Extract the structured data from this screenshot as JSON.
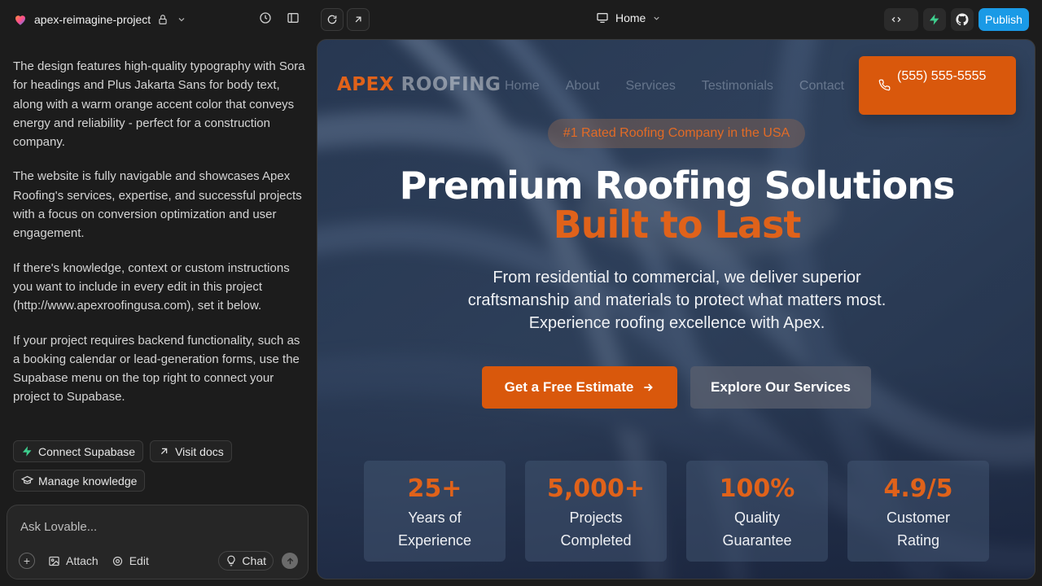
{
  "project": {
    "name": "apex-reimagine-project"
  },
  "chat": {
    "paragraphs": [
      "The design features high-quality typography with Sora for headings and Plus Jakarta Sans for body text, along with a warm orange accent color that conveys energy and reliability - perfect for a construction company.",
      "The website is fully navigable and showcases Apex Roofing's services, expertise, and successful projects with a focus on conversion optimization and user engagement.",
      "If there's knowledge, context or custom instructions you want to include in every edit in this project (http://www.apexroofingusa.com), set it below.",
      "If your project requires backend functionality, such as a booking calendar or lead-generation forms, use the Supabase menu on the top right to connect your project to Supabase."
    ],
    "chips": {
      "connect": "Connect Supabase",
      "docs": "Visit docs",
      "knowledge": "Manage knowledge"
    }
  },
  "composer": {
    "placeholder": "Ask Lovable...",
    "attach": "Attach",
    "edit": "Edit",
    "chat": "Chat"
  },
  "topbar": {
    "route": "Home",
    "publish": "Publish"
  },
  "site": {
    "logo_a": "APEX",
    "logo_b": "ROOFING",
    "nav": [
      "Home",
      "About",
      "Services",
      "Testimonials",
      "Contact"
    ],
    "phone": "(555) 555-5555",
    "badge": "#1 Rated Roofing Company in the USA",
    "headline_1": "Premium Roofing Solutions",
    "headline_2": "Built to Last",
    "subhead": "From residential to commercial, we deliver superior craftsmanship and materials to protect what matters most. Experience roofing excellence with Apex.",
    "cta_primary": "Get a Free Estimate",
    "cta_secondary": "Explore Our Services",
    "stats": [
      {
        "value": "25+",
        "label": "Years of Experience"
      },
      {
        "value": "5,000+",
        "label": "Projects Completed"
      },
      {
        "value": "100%",
        "label": "Quality Guarantee"
      },
      {
        "value": "4.9/5",
        "label": "Customer Rating"
      }
    ]
  },
  "colors": {
    "accent": "#d9580c",
    "publish": "#1a9ae6",
    "supabase": "#3ecf8e"
  }
}
